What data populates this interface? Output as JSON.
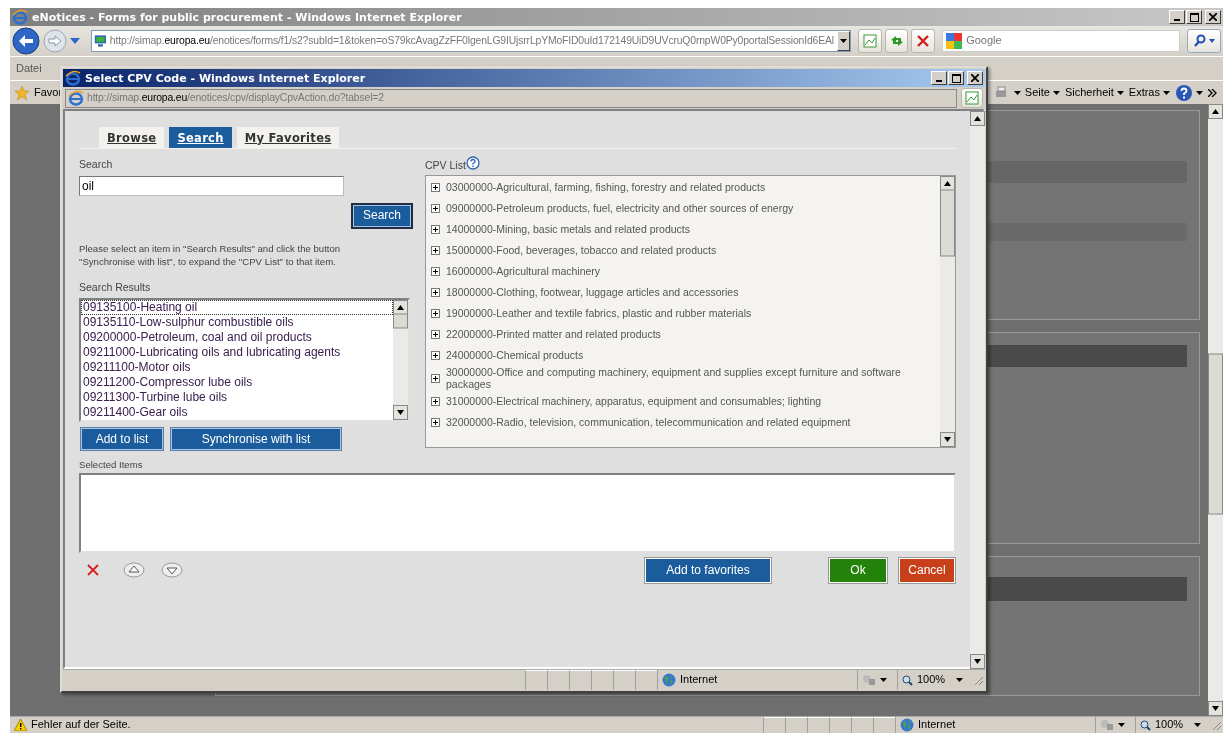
{
  "browser": {
    "title": "eNotices - Forms for public procurement - Windows Internet Explorer",
    "address": {
      "host": "http://simap.",
      "domain": "europa.eu",
      "path": "/enotices/forms/f1/s2?subId=1&token=oS79kcAvagZzFF0lgenLG9IUjsrrLpYMoFID0uId172149UiD9UVcruQ0rnpW0Py0portalSessionId6EAl"
    },
    "search_placeholder": "Google",
    "menu": [
      "Datei"
    ],
    "favorites_label": "Favor",
    "commands": [
      "Seite",
      "Sicherheit",
      "Extras"
    ],
    "status": {
      "message": "Fehler auf der Seite.",
      "zone": "Internet",
      "zoom": "100%"
    }
  },
  "dialog": {
    "title": "Select CPV Code - Windows Internet Explorer",
    "address": {
      "host": "http://simap.",
      "domain": "europa.eu",
      "path": "/enotices/cpv/displayCpvAction.do?tabsel=2"
    },
    "tabs": [
      {
        "label": "Browse",
        "selected": false
      },
      {
        "label": "Search",
        "selected": true
      },
      {
        "label": "My Favorites",
        "selected": false
      }
    ],
    "search": {
      "label": "Search",
      "value": "oil",
      "button": "Search"
    },
    "instructions": "Please select an item in \"Search Results\" and click the button \"Synchronise with list\", to expand the \"CPV List\" to that item.",
    "results": {
      "label": "Search Results",
      "items": [
        {
          "text": "09135100-Heating oil",
          "selected": true
        },
        {
          "text": "09135110-Low-sulphur combustible oils",
          "selected": false
        },
        {
          "text": "09200000-Petroleum, coal and oil products",
          "selected": false
        },
        {
          "text": "09211000-Lubricating oils and lubricating agents",
          "selected": false
        },
        {
          "text": "09211100-Motor oils",
          "selected": false
        },
        {
          "text": "09211200-Compressor lube oils",
          "selected": false
        },
        {
          "text": "09211300-Turbine lube oils",
          "selected": false
        },
        {
          "text": "09211400-Gear oils",
          "selected": false
        }
      ]
    },
    "result_buttons": [
      "Add to list",
      "Synchronise with list"
    ],
    "cpv_list": {
      "label": "CPV List",
      "items": [
        {
          "text": "03000000-Agricultural, farming, fishing, forestry and related products",
          "expanded": false
        },
        {
          "text": "09000000-Petroleum products, fuel, electricity and other sources of energy",
          "expanded": false
        },
        {
          "text": "14000000-Mining, basic metals and related products",
          "expanded": false
        },
        {
          "text": "15000000-Food, beverages, tobacco and related products",
          "expanded": false
        },
        {
          "text": "16000000-Agricultural machinery",
          "expanded": false
        },
        {
          "text": "18000000-Clothing, footwear, luggage articles and accessories",
          "expanded": false
        },
        {
          "text": "19000000-Leather and textile fabrics, plastic and rubber materials",
          "expanded": false
        },
        {
          "text": "22000000-Printed matter and related products",
          "expanded": false
        },
        {
          "text": "24000000-Chemical products",
          "expanded": false
        },
        {
          "text": "30000000-Office and computing machinery, equipment and supplies except furniture and software packages",
          "expanded": false
        },
        {
          "text": "31000000-Electrical machinery, apparatus, equipment and consumables; lighting",
          "expanded": false
        },
        {
          "text": "32000000-Radio, television, communication, telecommunication and related equipment",
          "expanded": false
        }
      ]
    },
    "selected_items": {
      "label": "Selected Items"
    },
    "actions": [
      {
        "label": "Add to favorites",
        "kind": "favorite"
      },
      {
        "label": "Ok",
        "kind": "ok"
      },
      {
        "label": "Cancel",
        "kind": "cancel"
      }
    ],
    "status": {
      "zone": "Internet",
      "zoom": "100%"
    }
  }
}
